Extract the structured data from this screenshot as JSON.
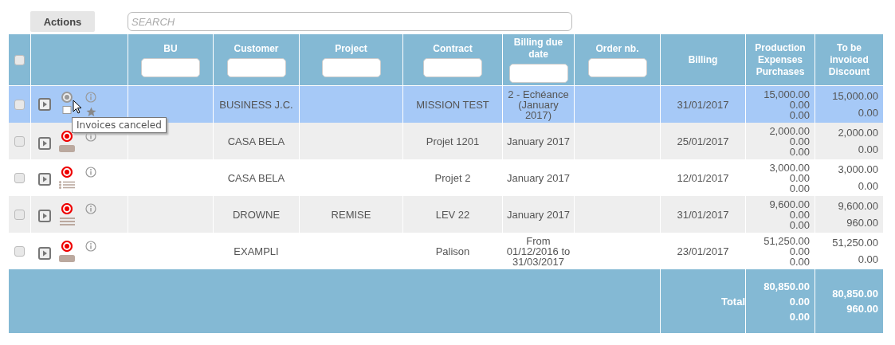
{
  "toolbar": {
    "actions_button": "Actions",
    "search": {
      "placeholder": "SEARCH"
    }
  },
  "table": {
    "select_all": {
      "checked": false
    },
    "columns": [
      {
        "label": "BU",
        "filter": true
      },
      {
        "label": "Customer",
        "filter": true
      },
      {
        "label": "Project",
        "filter": true
      },
      {
        "label": "Contract",
        "filter": true
      },
      {
        "label": "Billing due date",
        "filter": true
      },
      {
        "label": "Order nb.",
        "filter": true
      },
      {
        "label": "Billing",
        "filter": false
      },
      {
        "label": "Production Expenses Purchases",
        "filter": false
      },
      {
        "label": "To be invoiced Discount",
        "filter": false
      }
    ],
    "rows": [
      {
        "selected": true,
        "checked": false,
        "status_icon": {
          "kind": "canceled"
        },
        "type_icon": {
          "kind": "document"
        },
        "starred": true,
        "customer": "BUSINESS J.C.",
        "contract": "MISSION TEST",
        "due": "2 - Echéance (January 2017)",
        "billing": "31/01/2017",
        "amounts": [
          "15,000.00",
          "0.00",
          "0.00"
        ],
        "invoiced": [
          "15,000.00",
          "0.00"
        ]
      },
      {
        "selected": false,
        "checked": false,
        "status_icon": {
          "kind": "open"
        },
        "type_icon": {
          "kind": "tag"
        },
        "starred": false,
        "customer": "CASA BELA",
        "contract": "Projet 1201",
        "due": "January 2017",
        "billing": "25/01/2017",
        "amounts": [
          "2,000.00",
          "0.00",
          "0.00"
        ],
        "invoiced": [
          "2,000.00",
          "0.00"
        ]
      },
      {
        "selected": false,
        "checked": false,
        "status_icon": {
          "kind": "open"
        },
        "type_icon": {
          "kind": "list"
        },
        "starred": false,
        "customer": "CASA BELA",
        "contract": "Projet 2",
        "due": "January 2017",
        "billing": "12/01/2017",
        "amounts": [
          "3,000.00",
          "0.00",
          "0.00"
        ],
        "invoiced": [
          "3,000.00",
          "0.00"
        ]
      },
      {
        "selected": false,
        "checked": false,
        "status_icon": {
          "kind": "open"
        },
        "type_icon": {
          "kind": "lines"
        },
        "starred": false,
        "customer": "DROWNE",
        "project": "REMISE",
        "contract": "LEV 22",
        "due": "January 2017",
        "billing": "31/01/2017",
        "amounts": [
          "9,600.00",
          "0.00",
          "0.00"
        ],
        "invoiced": [
          "9,600.00",
          "960.00"
        ]
      },
      {
        "selected": false,
        "checked": false,
        "status_icon": {
          "kind": "open"
        },
        "type_icon": {
          "kind": "tag"
        },
        "starred": false,
        "customer": "EXAMPLI",
        "contract": "Palison",
        "due": "From 01/12/2016 to 31/03/2017",
        "billing": "23/01/2017",
        "amounts": [
          "51,250.00",
          "0.00",
          "0.00"
        ],
        "invoiced": [
          "51,250.00",
          "0.00"
        ]
      }
    ],
    "total": {
      "label": "Total",
      "amounts": [
        "80,850.00",
        "0.00",
        "0.00"
      ],
      "invoiced": [
        "80,850.00",
        "960.00"
      ]
    }
  },
  "tooltip": "Invoices canceled"
}
